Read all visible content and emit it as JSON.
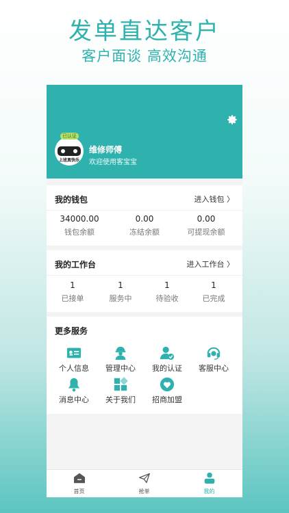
{
  "hero": {
    "title": "发单直达客户",
    "subtitle": "客户面谈 高效沟通"
  },
  "colors": {
    "accent": "#2fb2ae",
    "background": "#f4f4f4"
  },
  "profile": {
    "name": "维修师傅",
    "welcome": "欢迎使用客宝宝",
    "avatar_badge": "已认证",
    "avatar_text": "上班真快乐"
  },
  "wallet": {
    "title": "我的钱包",
    "link": "进入钱包 〉",
    "stats": [
      {
        "value": "34000.00",
        "label": "钱包余额"
      },
      {
        "value": "0.00",
        "label": "冻结余额"
      },
      {
        "value": "0.00",
        "label": "可提现余额"
      }
    ]
  },
  "workbench": {
    "title": "我的工作台",
    "link": "进入工作台 〉",
    "stats": [
      {
        "value": "1",
        "label": "已接单"
      },
      {
        "value": "1",
        "label": "服务中"
      },
      {
        "value": "1",
        "label": "待验收"
      },
      {
        "value": "1",
        "label": "已完成"
      }
    ]
  },
  "services": {
    "title": "更多服务",
    "items": [
      {
        "label": "个人信息",
        "icon": "id-card-icon"
      },
      {
        "label": "管理中心",
        "icon": "worker-icon"
      },
      {
        "label": "我的认证",
        "icon": "verified-user-icon"
      },
      {
        "label": "客服中心",
        "icon": "headset-icon"
      },
      {
        "label": "消息中心",
        "icon": "bell-icon"
      },
      {
        "label": "关于我们",
        "icon": "grid-icon"
      },
      {
        "label": "招商加盟",
        "icon": "heart-icon"
      }
    ]
  },
  "tabbar": {
    "items": [
      {
        "label": "首页",
        "icon": "home-icon"
      },
      {
        "label": "抢单",
        "icon": "paper-plane-icon"
      },
      {
        "label": "我的",
        "icon": "user-icon",
        "active": true
      }
    ]
  }
}
